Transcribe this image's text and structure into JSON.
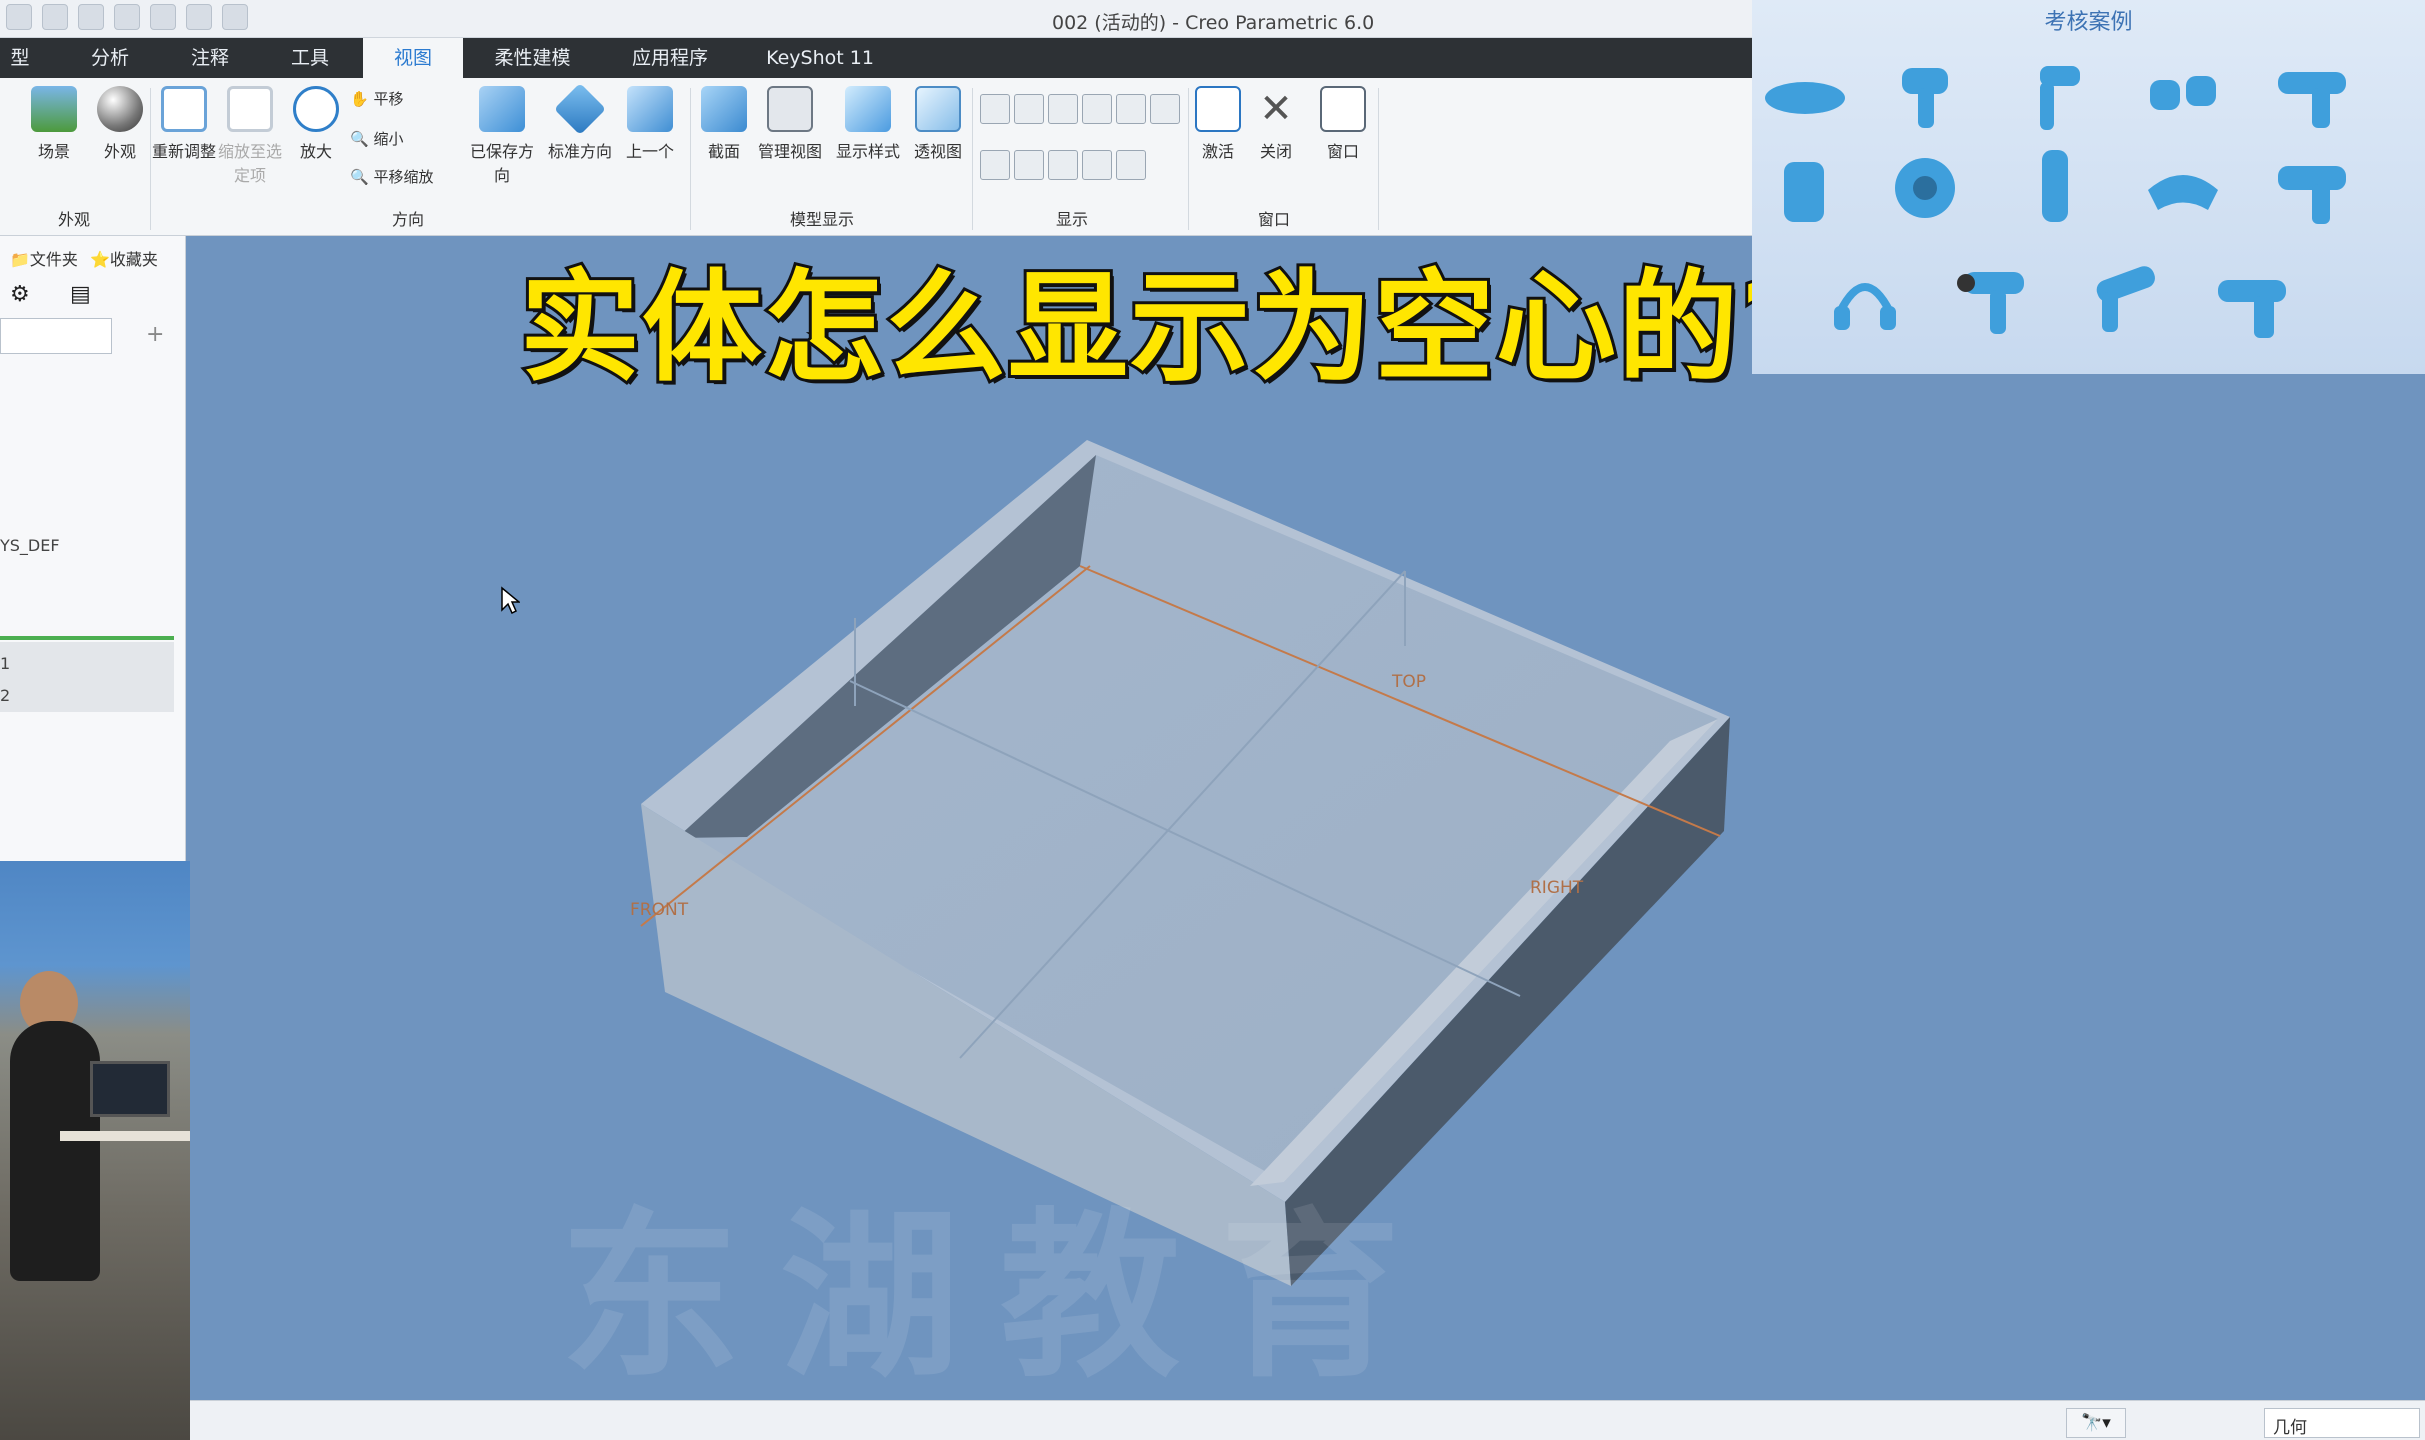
{
  "window": {
    "title": "002 (活动的) - Creo Parametric 6.0"
  },
  "tabs": [
    "型",
    "分析",
    "注释",
    "工具",
    "视图",
    "柔性建模",
    "应用程序",
    "KeyShot 11"
  ],
  "active_tab": "视图",
  "ribbon": {
    "appearance": {
      "scene": "场景",
      "appearance": "外观",
      "group": "外观"
    },
    "orientation": {
      "refit": "重新调整",
      "zoom_to_selected": "缩放至选定项",
      "zoom_in": "放大",
      "pan": "平移",
      "zoom_out": "缩小",
      "pan_zoom": "平移缩放",
      "saved_orientations": "已保存方向",
      "standard_orientation": "标准方向",
      "previous": "上一个",
      "group": "方向"
    },
    "model_display": {
      "section": "截面",
      "manage_views": "管理视图",
      "display_style": "显示样式",
      "perspective": "透视图",
      "group": "模型显示"
    },
    "show": {
      "group": "显示"
    },
    "window": {
      "activate": "激活",
      "close": "关闭",
      "windows": "窗口",
      "group": "窗口"
    }
  },
  "left_panel": {
    "tabs": [
      "文件夹",
      "收藏夹"
    ],
    "tree_items": [
      "YS_DEF",
      "1",
      "2"
    ]
  },
  "viewport": {
    "plane_labels": {
      "front": "FRONT",
      "top": "TOP",
      "right": "RIGHT"
    },
    "watermark": "东湖教育"
  },
  "caption": "实体怎么显示为空心的?",
  "exam_panel": {
    "title": "考核案例",
    "accent_color": "#3f9fdc"
  },
  "status_bar": {
    "filter_value": "几何"
  }
}
